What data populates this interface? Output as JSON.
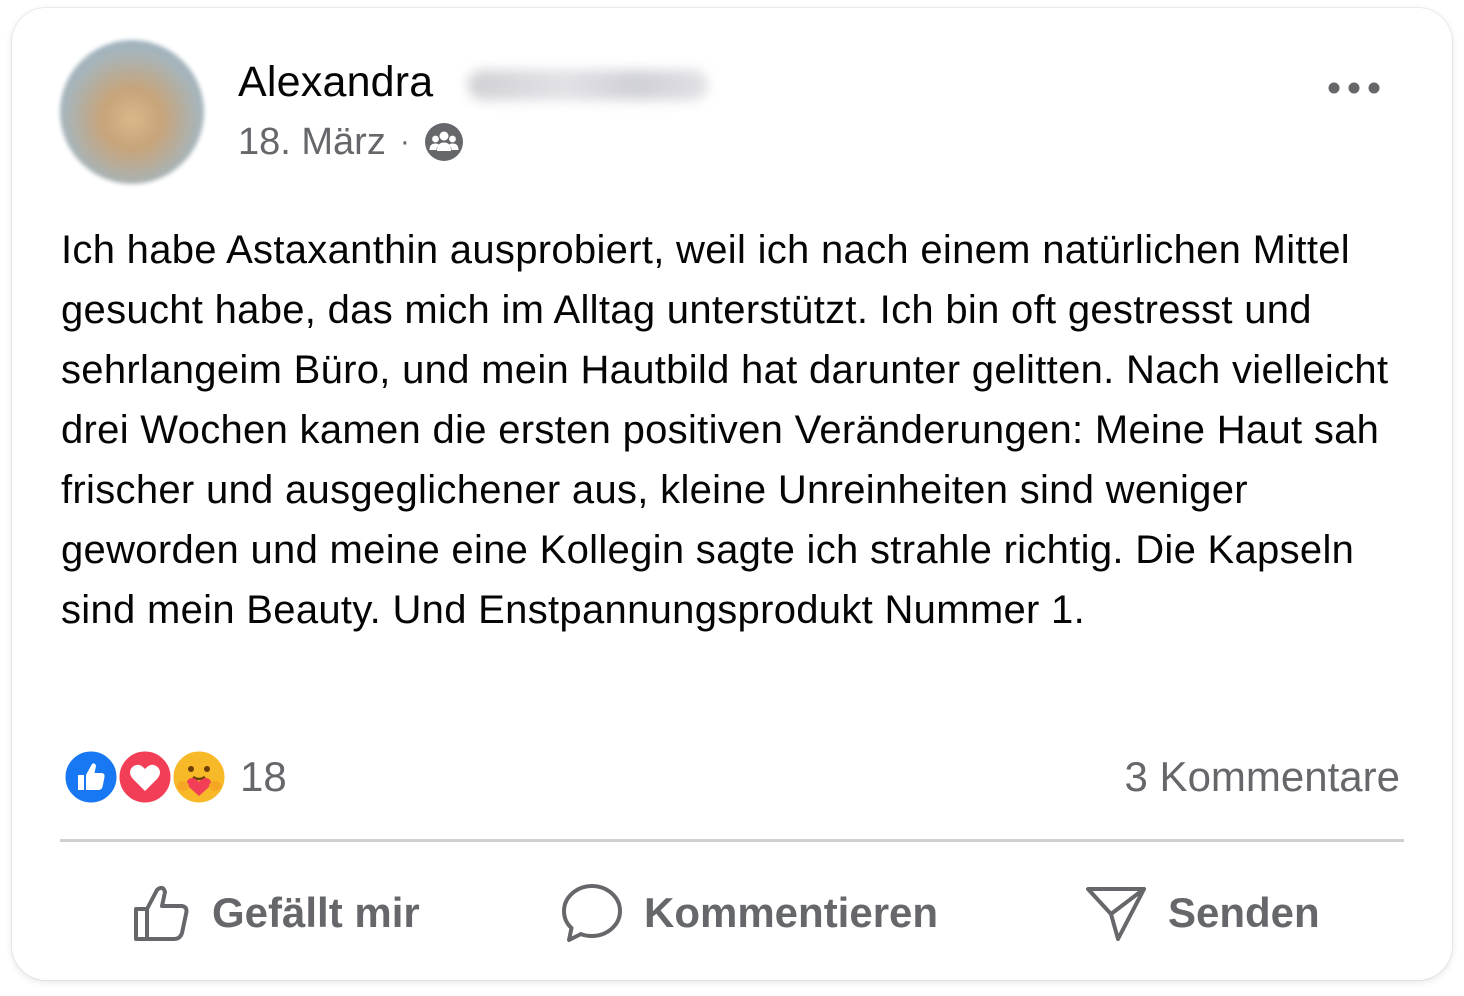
{
  "post": {
    "author": {
      "name": "Alexandra",
      "surname_redacted": true
    },
    "date": "18. März",
    "separator": "·",
    "audience_icon": "friends-icon",
    "more_icon": "more-options-icon",
    "text": "Ich habe Astaxanthin ausprobiert, weil ich nach einem natürlichen Mittel gesucht habe, das mich im Alltag unterstützt. Ich bin oft gestresst und sehrlangeim Büro, und mein Hautbild hat darunter gelitten. Nach vielleicht drei Wochen kamen die ersten positiven Veränderungen: Meine Haut sah frischer und ausgeglichener aus, kleine Unreinheiten sind weniger geworden und meine eine Kollegin sagte ich strahle richtig. Die Kapseln sind mein Beauty. Und Enstpannungsprodukt Nummer 1."
  },
  "engagement": {
    "reactions": [
      "like",
      "love",
      "care"
    ],
    "reaction_count": "18",
    "comments_label": "3 Kommentare"
  },
  "actions": {
    "like_label": "Gefällt mir",
    "comment_label": "Kommentieren",
    "send_label": "Senden"
  },
  "colors": {
    "text_primary": "#050505",
    "text_secondary": "#65676b",
    "like_blue": "#1877f2",
    "love_red": "#f33e58",
    "care_yellow": "#f7b928",
    "divider": "#ced0d4"
  }
}
